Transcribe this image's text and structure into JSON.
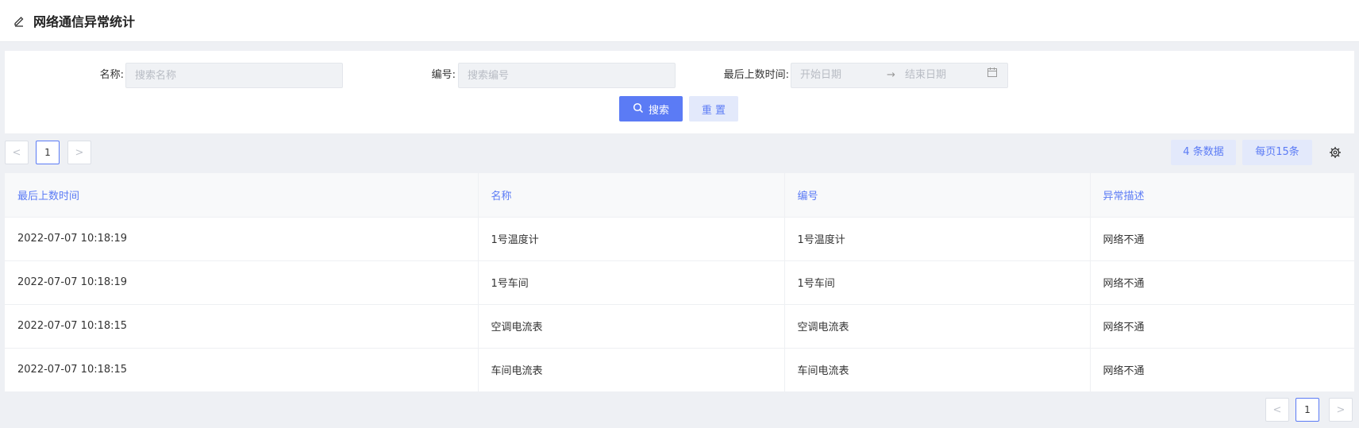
{
  "header": {
    "title": "网络通信异常统计",
    "icon": "edit-icon"
  },
  "filters": {
    "name_label": "名称:",
    "name_placeholder": "搜索名称",
    "code_label": "编号:",
    "code_placeholder": "搜索编号",
    "time_label": "最后上数时间:",
    "date_start_placeholder": "开始日期",
    "date_arrow": "→",
    "date_end_placeholder": "结束日期",
    "search_button": "搜索",
    "reset_button": "重 置"
  },
  "pagination_top": {
    "prev": "<",
    "page": "1",
    "next": ">"
  },
  "toolbar": {
    "count": "4 条数据",
    "page_size": "每页15条"
  },
  "table": {
    "columns": [
      "最后上数时间",
      "名称",
      "编号",
      "异常描述"
    ],
    "rows": [
      [
        "2022-07-07 10:18:19",
        "1号温度计",
        "1号温度计",
        "网络不通"
      ],
      [
        "2022-07-07 10:18:19",
        "1号车间",
        "1号车间",
        "网络不通"
      ],
      [
        "2022-07-07 10:18:15",
        "空调电流表",
        "空调电流表",
        "网络不通"
      ],
      [
        "2022-07-07 10:18:15",
        "车间电流表",
        "车间电流表",
        "网络不通"
      ]
    ]
  },
  "pagination_bottom": {
    "prev": "<",
    "page": "1",
    "next": ">"
  },
  "colors": {
    "accent": "#5b7bf5",
    "accent_light": "#e3e9fb",
    "background": "#eef0f4"
  }
}
